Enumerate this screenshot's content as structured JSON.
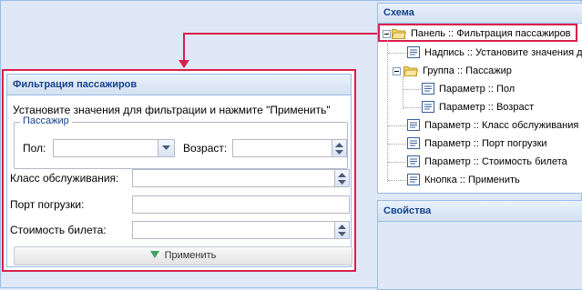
{
  "form": {
    "title": "Фильтрация пассажиров",
    "instruction": "Установите значения для фильтрации и нажмите \"Применить\"",
    "group_legend": "Пассажир",
    "gender_label": "Пол:",
    "gender_value": "",
    "age_label": "Возраст:",
    "age_value": "",
    "class_label": "Класс обслуживания:",
    "class_value": "",
    "port_label": "Порт погрузки:",
    "port_value": "",
    "fare_label": "Стоимость билета:",
    "fare_value": "",
    "apply_label": "Применить"
  },
  "schema": {
    "title": "Схема",
    "tree": [
      {
        "label": "Панель :: Фильтрация пассажиров",
        "icon": "folder-open-icon",
        "selected": true
      },
      {
        "label": "Надпись :: Установите значения д",
        "icon": "field-icon"
      },
      {
        "label": "Группа :: Пассажир",
        "icon": "folder-open-icon"
      },
      {
        "label": "Параметр :: Пол",
        "icon": "field-icon"
      },
      {
        "label": "Параметр :: Возраст",
        "icon": "field-icon"
      },
      {
        "label": "Параметр :: Класс обслуживания",
        "icon": "field-icon"
      },
      {
        "label": "Параметр :: Порт погрузки",
        "icon": "field-icon"
      },
      {
        "label": "Параметр :: Стоимость билета",
        "icon": "field-icon"
      },
      {
        "label": "Кнопка :: Применить",
        "icon": "field-icon"
      }
    ]
  },
  "properties": {
    "title": "Свойства"
  },
  "colors": {
    "highlight": "#d9204c",
    "header_text": "#15428b",
    "border": "#99bbe8"
  }
}
